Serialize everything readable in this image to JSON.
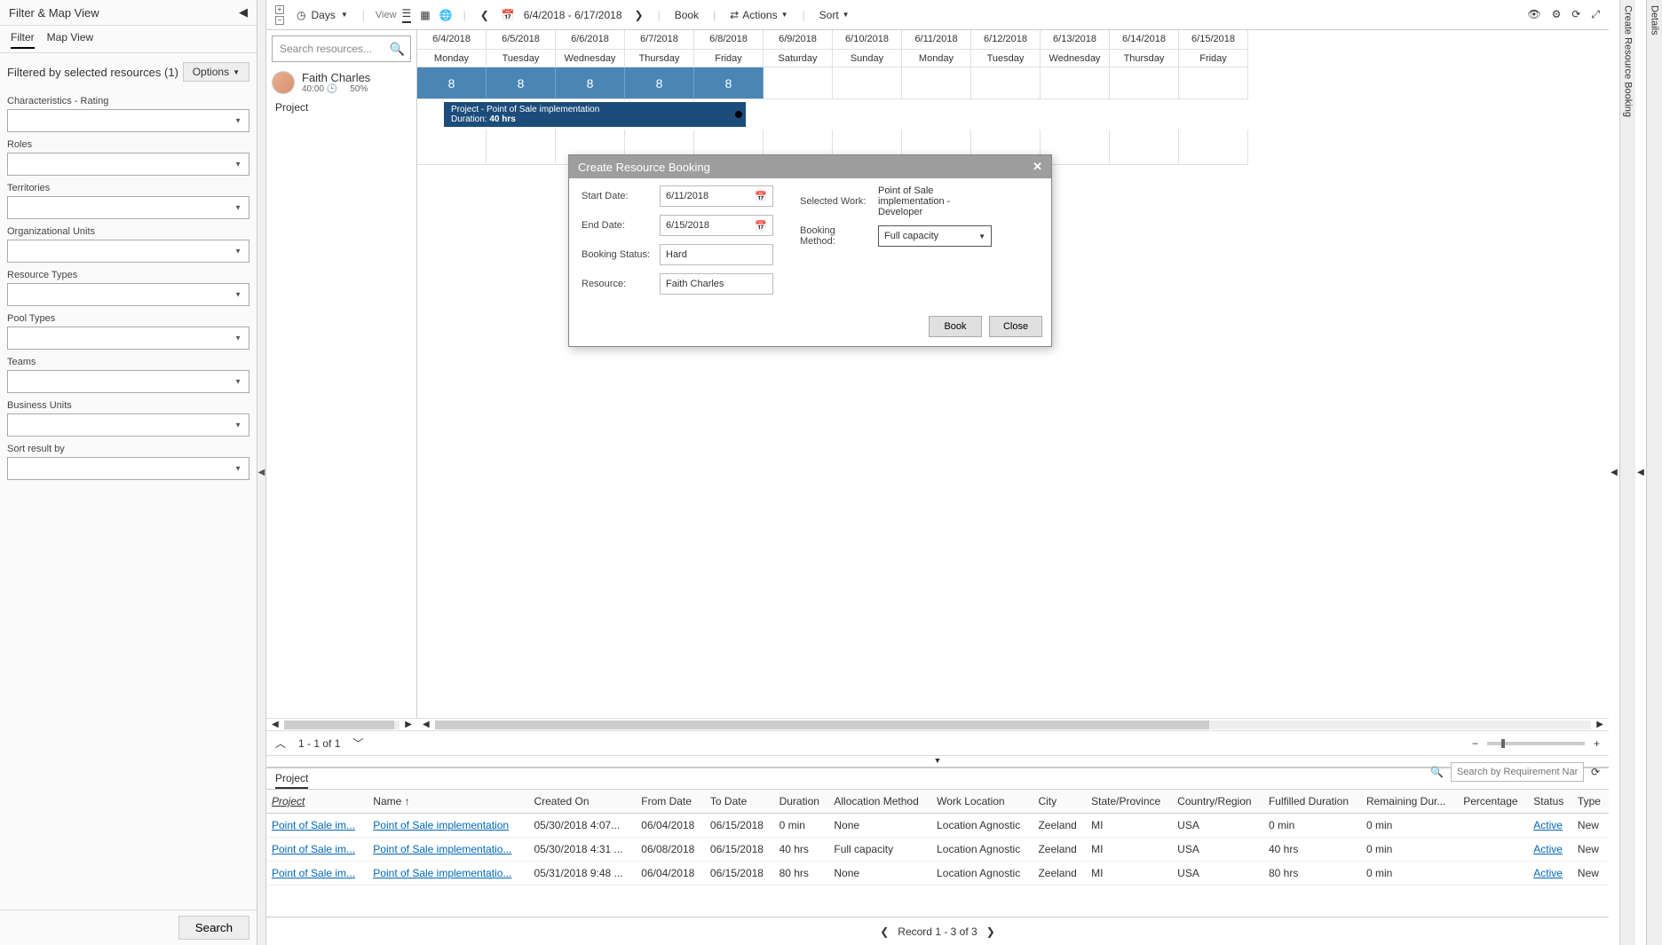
{
  "sidebar": {
    "header": "Filter & Map View",
    "tabs": {
      "filter": "Filter",
      "map": "Map View"
    },
    "summary": "Filtered by selected resources (1)",
    "options_label": "Options",
    "filters": [
      "Characteristics - Rating",
      "Roles",
      "Territories",
      "Organizational Units",
      "Resource Types",
      "Pool Types",
      "Teams",
      "Business Units",
      "Sort result by"
    ],
    "search_label": "Search"
  },
  "toolbar": {
    "days_label": "Days",
    "view_label": "View",
    "date_range": "6/4/2018 - 6/17/2018",
    "book_label": "Book",
    "actions_label": "Actions",
    "sort_label": "Sort"
  },
  "schedule": {
    "search_placeholder": "Search resources...",
    "resource": {
      "name": "Faith Charles",
      "hours": "40:00",
      "pct": "50%"
    },
    "project_label": "Project",
    "days": [
      {
        "date": "6/4/2018",
        "dow": "Monday",
        "booked": "8"
      },
      {
        "date": "6/5/2018",
        "dow": "Tuesday",
        "booked": "8"
      },
      {
        "date": "6/6/2018",
        "dow": "Wednesday",
        "booked": "8"
      },
      {
        "date": "6/7/2018",
        "dow": "Thursday",
        "booked": "8"
      },
      {
        "date": "6/8/2018",
        "dow": "Friday",
        "booked": "8"
      },
      {
        "date": "6/9/2018",
        "dow": "Saturday",
        "booked": ""
      },
      {
        "date": "6/10/2018",
        "dow": "Sunday",
        "booked": ""
      },
      {
        "date": "6/11/2018",
        "dow": "Monday",
        "booked": ""
      },
      {
        "date": "6/12/2018",
        "dow": "Tuesday",
        "booked": ""
      },
      {
        "date": "6/13/2018",
        "dow": "Wednesday",
        "booked": ""
      },
      {
        "date": "6/14/2018",
        "dow": "Thursday",
        "booked": ""
      },
      {
        "date": "6/15/2018",
        "dow": "Friday",
        "booked": ""
      }
    ],
    "project_bar": {
      "title": "Project - Point of Sale implementation",
      "duration_label": "Duration:",
      "duration": "40 hrs"
    },
    "pager": "1 - 1 of 1"
  },
  "modal": {
    "title": "Create Resource Booking",
    "start_date_label": "Start Date:",
    "start_date": "6/11/2018",
    "end_date_label": "End Date:",
    "end_date": "6/15/2018",
    "status_label": "Booking Status:",
    "status": "Hard",
    "resource_label": "Resource:",
    "resource": "Faith Charles",
    "selected_work_label": "Selected Work:",
    "selected_work": "Point of Sale implementation - Developer",
    "method_label": "Booking Method:",
    "method": "Full capacity",
    "book_btn": "Book",
    "close_btn": "Close"
  },
  "bottom": {
    "tab": "Project",
    "search_placeholder": "Search by Requirement Name",
    "columns": [
      "Project",
      "Name",
      "Created On",
      "From Date",
      "To Date",
      "Duration",
      "Allocation Method",
      "Work Location",
      "City",
      "State/Province",
      "Country/Region",
      "Fulfilled Duration",
      "Remaining Dur...",
      "Percentage",
      "Status",
      "Type"
    ],
    "rows": [
      {
        "project": "Point of Sale im...",
        "name": "Point of Sale implementation",
        "created": "05/30/2018 4:07...",
        "from": "06/04/2018",
        "to": "06/15/2018",
        "duration": "0 min",
        "alloc": "None",
        "workloc": "Location Agnostic",
        "city": "Zeeland",
        "state": "MI",
        "country": "USA",
        "fulfilled": "0 min",
        "remaining": "0 min",
        "pct": "",
        "status": "Active",
        "type": "New"
      },
      {
        "project": "Point of Sale im...",
        "name": "Point of Sale implementatio...",
        "created": "05/30/2018 4:31 ...",
        "from": "06/08/2018",
        "to": "06/15/2018",
        "duration": "40 hrs",
        "alloc": "Full capacity",
        "workloc": "Location Agnostic",
        "city": "Zeeland",
        "state": "MI",
        "country": "USA",
        "fulfilled": "40 hrs",
        "remaining": "0 min",
        "pct": "",
        "status": "Active",
        "type": "New"
      },
      {
        "project": "Point of Sale im...",
        "name": "Point of Sale implementatio...",
        "created": "05/31/2018 9:48 ...",
        "from": "06/04/2018",
        "to": "06/15/2018",
        "duration": "80 hrs",
        "alloc": "None",
        "workloc": "Location Agnostic",
        "city": "Zeeland",
        "state": "MI",
        "country": "USA",
        "fulfilled": "80 hrs",
        "remaining": "0 min",
        "pct": "",
        "status": "Active",
        "type": "New"
      }
    ],
    "pager": "Record 1 - 3 of 3"
  },
  "right_panels": {
    "details": "Details",
    "create_booking": "Create Resource Booking"
  }
}
